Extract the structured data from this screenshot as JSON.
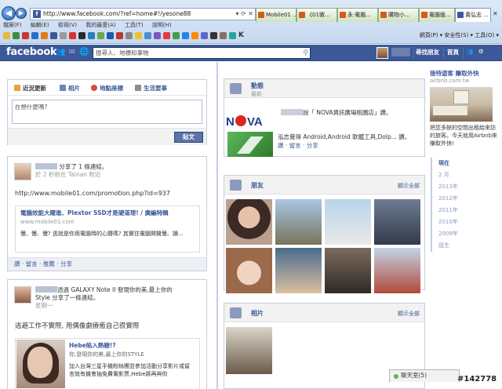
{
  "browser": {
    "address": "http://www.facebook.com/?ref=home#!/yesone88",
    "tabs": [
      {
        "label": "Mobile01 ...",
        "active": false
      },
      {
        "label": "《01微...",
        "active": false
      },
      {
        "label": "永·電腦...",
        "active": false
      },
      {
        "label": "購物小...",
        "active": false
      },
      {
        "label": "電腦版...",
        "active": false
      },
      {
        "label": "黃弘志 ...",
        "active": true
      }
    ],
    "menu": [
      "檔案(F)",
      "編輯(E)",
      "檢視(V)",
      "我的最愛(A)",
      "工具(T)",
      "說明(H)"
    ],
    "fav_right": "網頁(P) ▾  安全性(S) ▾  工具(O) ▾"
  },
  "fb": {
    "logo": "facebook",
    "search_placeholder": "搜尋人、地標和事物",
    "nav": {
      "find_friends": "尋找朋友",
      "home": "首頁"
    }
  },
  "composer": {
    "tabs": [
      "近況更新",
      "相片",
      "地點座標",
      "生活要事"
    ],
    "placeholder": "在想什麼嗎?",
    "post_label": "貼文"
  },
  "post1": {
    "action": "分享了 1 條連結。",
    "time": "於 2 秒前在 Tainan 附近",
    "url_text": "http://www.mobile01.com/promotion.php?id=937",
    "box_title": "電腦效能大躍進、Plextor SSD才是硬道理! / 廣編特輯",
    "box_source": "www.mobile01.com",
    "box_desc": "慢、慢、慢? 逃就是你用電腦時的心聲嗎? 其實往電腦開機慢、讀...",
    "actions": "讚 · 留言 · 推薦 · 分享"
  },
  "post2": {
    "line1": "透過 GALAXY Note II 發現你的美,最上你的",
    "line2": "Style 分享了一條連結。",
    "time": "星期一",
    "headline": "逃避工作不實際, 用偶像劇療癒自己很實際",
    "box_title": "Hebe陷入熱戀!?",
    "box_sub": "你,發現你的美,最上你的STYLE",
    "box_desc": "加入台灣三星手機粉絲團並參加活動分享影片或留言就有機會抽免費電影票,Hebe將再與你"
  },
  "activity": {
    "title": "動態",
    "sub": "最新",
    "line1": "說「 NOVA資訊廣場桃園店」讚。",
    "line2": "泓志覺得 Android,Android 軟體工具,Dolp... 讚。",
    "line2_actions": "讚 · 留言 · 分享"
  },
  "friends": {
    "title": "朋友",
    "link": "顯示全部"
  },
  "photos": {
    "title": "相片",
    "link": "顯示全部"
  },
  "side_ad": {
    "title": "接待遊客 賺取外快",
    "url": "airbnb.com.tw",
    "desc": "把您多餘的空間出租給來訪的旅客。今天就用Airbnb來賺取外快!"
  },
  "years": [
    "現在",
    "2 月",
    "2013年",
    "2012年",
    "2011年",
    "2010年",
    "2009年",
    "誕生"
  ],
  "chat": {
    "label": "聊天室(5)"
  },
  "watermark": "#142778"
}
